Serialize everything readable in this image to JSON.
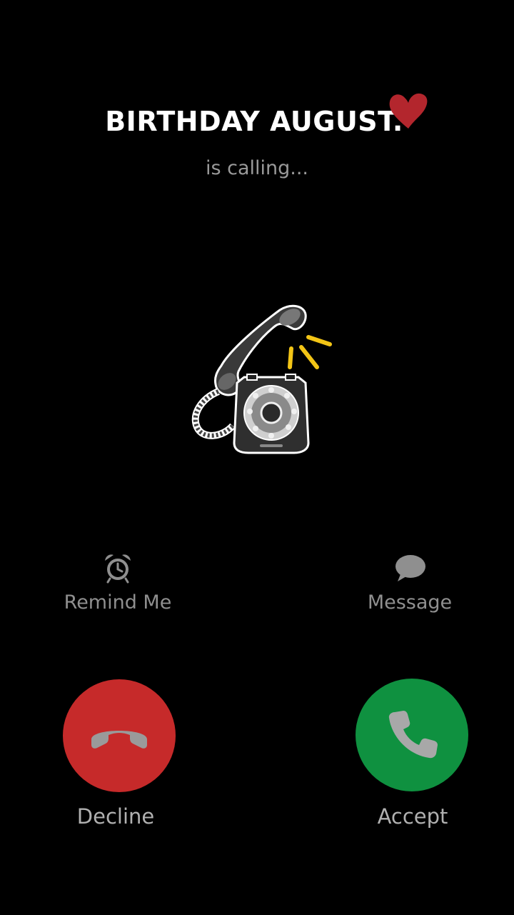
{
  "caller": {
    "name": "BIRTHDAY AUGUST.",
    "status": "is calling..."
  },
  "actions": {
    "remind_label": "Remind Me",
    "remind_icon": "alarm-clock-icon",
    "message_label": "Message",
    "message_icon": "chat-bubble-icon"
  },
  "call_controls": {
    "decline_label": "Decline",
    "decline_icon": "hang-up-icon",
    "accept_label": "Accept",
    "accept_icon": "phone-handset-icon"
  },
  "colors": {
    "background": "#000000",
    "decline": "#c62a2a",
    "accept": "#0f9140",
    "heart": "#b3262d",
    "ring_lines": "#f3c516"
  }
}
